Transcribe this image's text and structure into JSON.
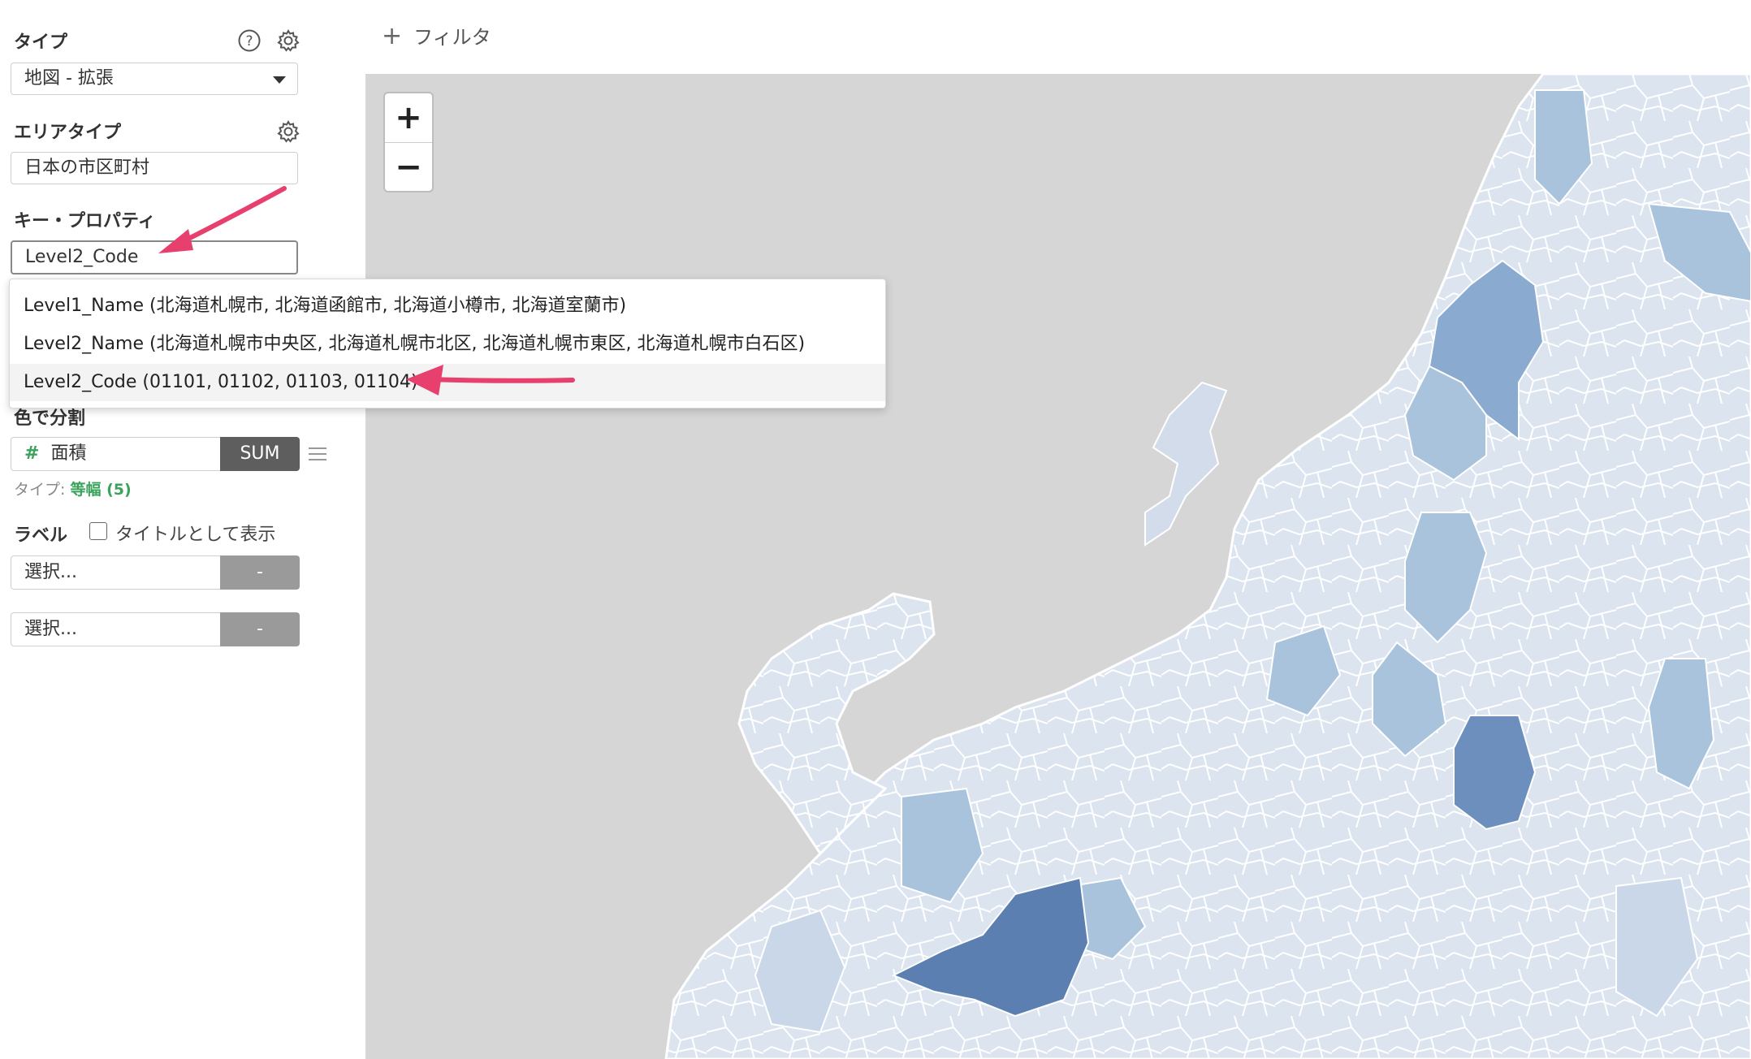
{
  "sidebar": {
    "type_section": {
      "title": "タイプ",
      "selected": "地図 - 拡張"
    },
    "area_section": {
      "title": "エリアタイプ",
      "value": "日本の市区町村"
    },
    "key_section": {
      "title": "キー・プロパティ",
      "value": "Level2_Code"
    },
    "dropdown": {
      "items": [
        "Level1_Name (北海道札幌市, 北海道函館市, 北海道小樽市, 北海道室蘭市)",
        "Level2_Name (北海道札幌市中央区, 北海道札幌市北区, 北海道札幌市東区, 北海道札幌市白石区)",
        "Level2_Code (01101, 01102, 01103, 01104)"
      ]
    },
    "color_section": {
      "title": "色で分割",
      "field": "面積",
      "agg": "SUM",
      "type_label": "タイプ:",
      "type_value": "等幅 (5)"
    },
    "label_section": {
      "title": "ラベル",
      "checkbox_label": "タイトルとして表示",
      "select1": "選択...",
      "select1_btn": "-",
      "select2": "選択...",
      "select2_btn": "-"
    }
  },
  "filter": {
    "icon": "plus-icon",
    "label": "フィルタ"
  },
  "map": {
    "zoom_in": "+",
    "zoom_out": "−",
    "colors": {
      "background": "#d6d6d6",
      "light": "#dbe4ef",
      "mid": "#a9c3dc",
      "dark": "#6c8fbd",
      "darkest": "#5a7fb0",
      "border": "#ffffff"
    }
  },
  "annotation_color": "#e8406e"
}
